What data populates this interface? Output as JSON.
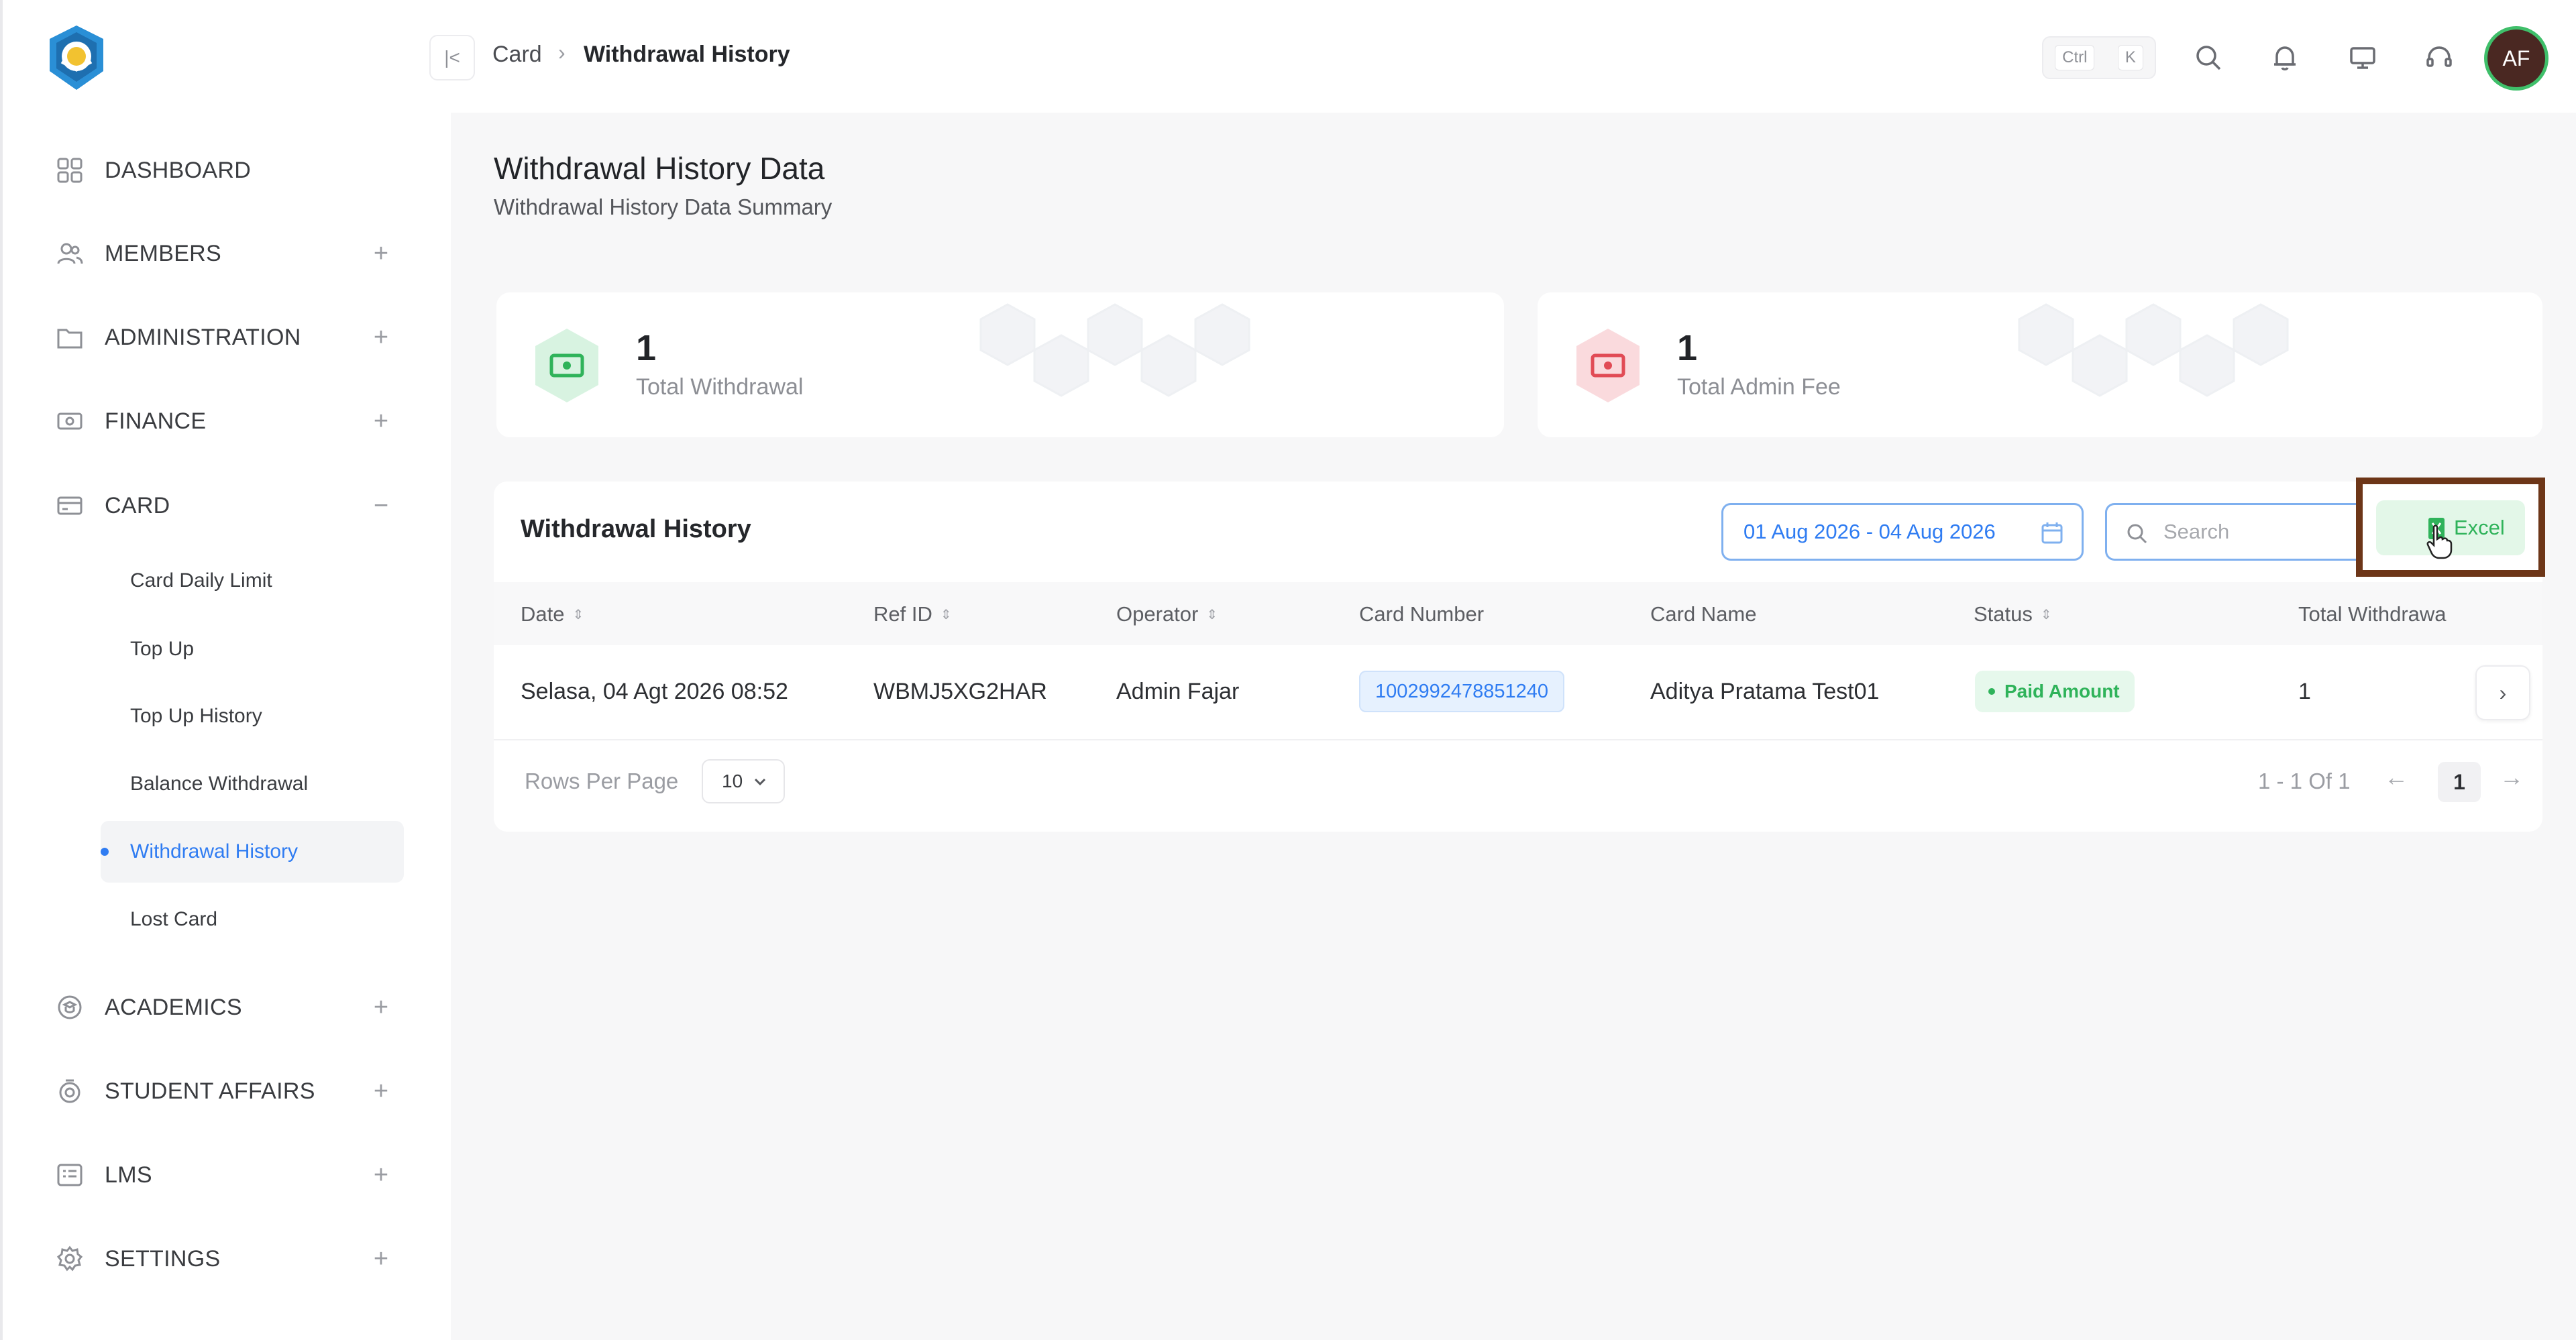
{
  "brand": {
    "logo_icon": "tut-wuri-handayani-logo"
  },
  "sidebar": {
    "items": [
      {
        "label": "DASHBOARD",
        "icon": "grid-icon",
        "toggle": ""
      },
      {
        "label": "MEMBERS",
        "icon": "users-icon",
        "toggle": "+"
      },
      {
        "label": "ADMINISTRATION",
        "icon": "folder-icon",
        "toggle": "+"
      },
      {
        "label": "FINANCE",
        "icon": "money-icon",
        "toggle": "+"
      },
      {
        "label": "CARD",
        "icon": "card-icon",
        "toggle": "−"
      },
      {
        "label": "ACADEMICS",
        "icon": "academics-icon",
        "toggle": "+"
      },
      {
        "label": "STUDENT AFFAIRS",
        "icon": "badge-icon",
        "toggle": "+"
      },
      {
        "label": "LMS",
        "icon": "list-icon",
        "toggle": "+"
      },
      {
        "label": "SETTINGS",
        "icon": "gear-icon",
        "toggle": "+"
      }
    ],
    "card_subitems": [
      {
        "label": "Card Daily Limit"
      },
      {
        "label": "Top Up"
      },
      {
        "label": "Top Up History"
      },
      {
        "label": "Balance Withdrawal"
      },
      {
        "label": "Withdrawal History",
        "active": true
      },
      {
        "label": "Lost Card"
      }
    ]
  },
  "topbar": {
    "breadcrumb": [
      "Card",
      "Withdrawal History"
    ],
    "shortcut": [
      "Ctrl",
      "K"
    ],
    "avatar_initials": "AF"
  },
  "page": {
    "title": "Withdrawal History Data",
    "subtitle": "Withdrawal History Data Summary"
  },
  "stats": [
    {
      "value": "1",
      "label": "Total Withdrawal",
      "color": "#3fbf6a"
    },
    {
      "value": "1",
      "label": "Total Admin Fee",
      "color": "#e14b55"
    }
  ],
  "table": {
    "title": "Withdrawal History",
    "date_range": "01 Aug 2026 - 04 Aug 2026",
    "search_placeholder": "Search",
    "excel_label": "Excel",
    "columns": [
      "Date",
      "Ref ID",
      "Operator",
      "Card Number",
      "Card Name",
      "Status",
      "Total Withdrawa"
    ],
    "rows": [
      {
        "date": "Selasa, 04 Agt 2026 08:52",
        "ref_id": "WBMJ5XG2HAR",
        "operator": "Admin Fajar",
        "card_number": "1002992478851240",
        "card_name": "Aditya Pratama Test01",
        "status": "Paid Amount",
        "total": "1"
      }
    ],
    "rows_per_page_label": "Rows Per Page",
    "rows_per_page": "10",
    "page_info": "1 - 1 Of 1",
    "current_page": "1"
  },
  "colors": {
    "accent_blue": "#2f7cf2",
    "success_green": "#2fb35a",
    "danger_red": "#e14b55",
    "highlight_frame": "#6d3618"
  }
}
